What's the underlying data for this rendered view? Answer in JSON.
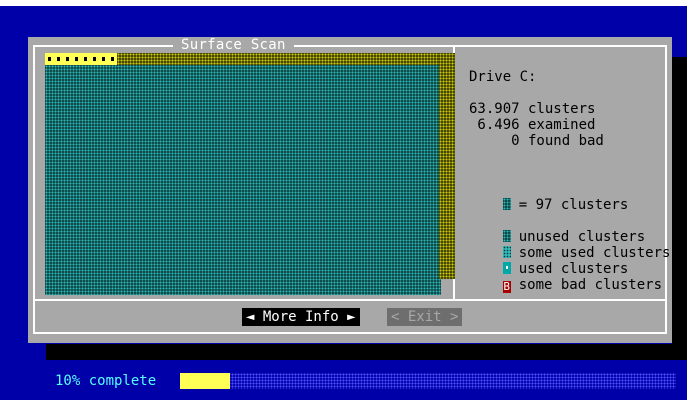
{
  "dialog": {
    "title": "Surface Scan"
  },
  "info": {
    "drive": "Drive C:",
    "clusters_total": "63.907 clusters",
    "examined": " 6.496 examined",
    "found_bad": "     0 found bad",
    "cell_ratio": "= 97 clusters"
  },
  "legend": [
    {
      "label": "unused clusters",
      "symbol": ""
    },
    {
      "label": "some used clusters",
      "symbol": ""
    },
    {
      "label": "used clusters",
      "symbol": ""
    },
    {
      "label": "some bad clusters",
      "symbol": "B"
    }
  ],
  "buttons": {
    "more_info": "◄ More Info ►",
    "exit": "< Exit >"
  },
  "status": {
    "progress_text": "10% complete",
    "progress_value": 0.1
  },
  "map": {
    "used_cells": 8
  },
  "colors": {
    "background": "#0000a8",
    "dialog": "#a8a8a8",
    "progress_fill": "#ffff55",
    "status_text": "#55ffff"
  }
}
